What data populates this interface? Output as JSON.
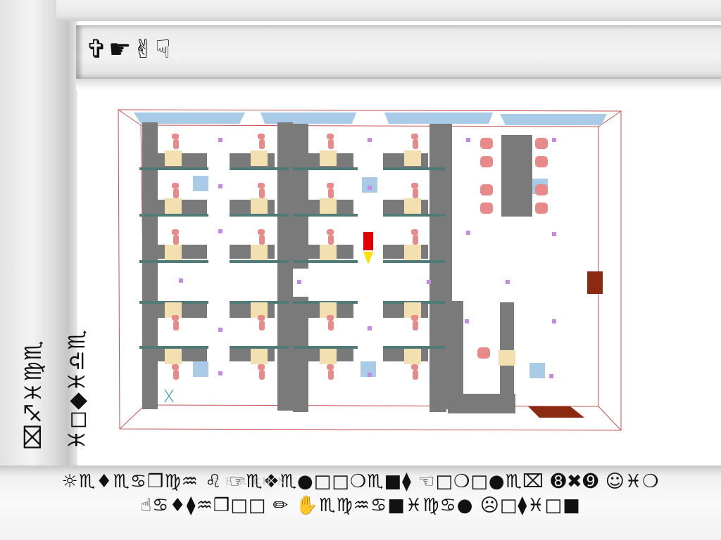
{
  "slide": {
    "title_glyphs": "✞☛✌☟",
    "vertical_text": {
      "line1": "⌧♐♓♍♏",
      "line2": "♓◻◆♓♎♏",
      "extra": "✍"
    },
    "footer": {
      "line1": "☼♏♦♏♋❒♍♒ ♌ ☞♏❖♏●□□❍♏■⧫ ☜□❍□●♏⌧ ➑✖➒ ☺♓❍",
      "line2": "☝♋♦⧫♒❒□□ ✏ ✋♏♍♒♋■♓♍♋● ☹□⧫♓□■",
      "faint_overlay": "R             E  R      CH      N"
    }
  },
  "floorplan": {
    "caption": ""
  },
  "colors": {
    "wall": "#7a7a7a",
    "desk": "#f3e0b0",
    "figure": "#e88a8a",
    "marker": "#c58be0",
    "window": "#a9cbe8",
    "outline": "#c04040",
    "door": "#8a2a10",
    "exit_red": "#e00000",
    "exit_yellow": "#ffe000"
  }
}
